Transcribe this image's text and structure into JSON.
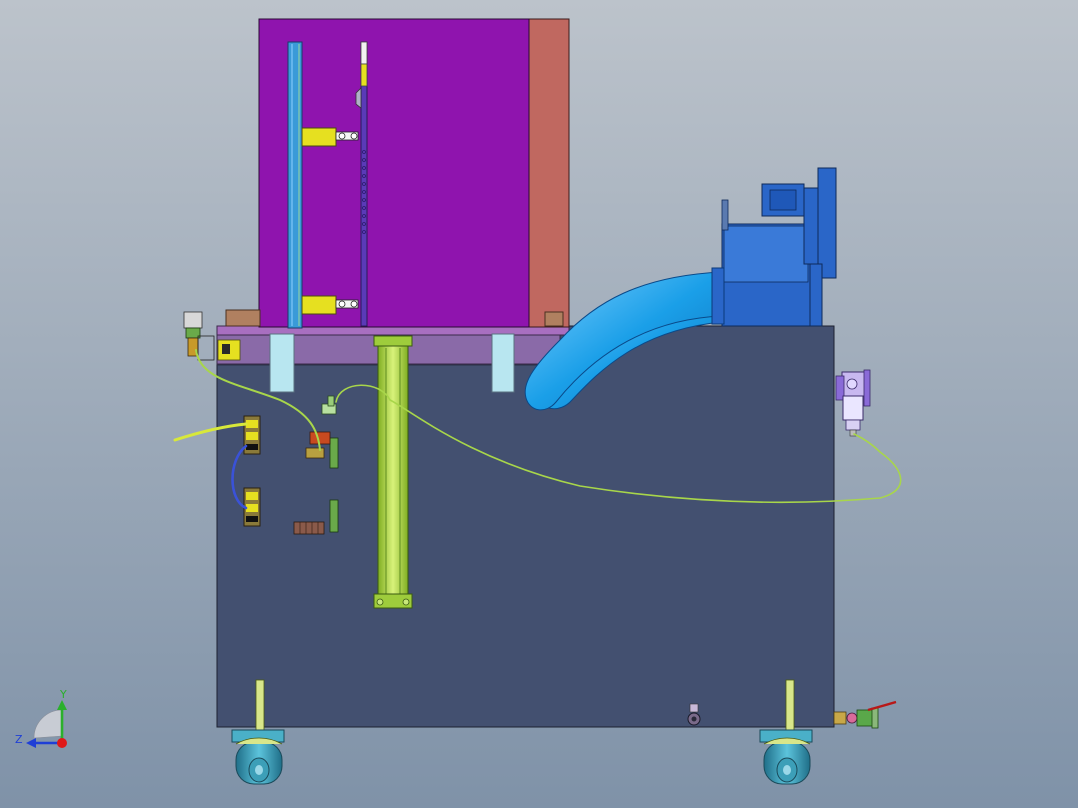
{
  "viewport": {
    "background_top": "#bcc3cb",
    "background_bottom": "#7f92a8"
  },
  "triad": {
    "y_label": "Y",
    "z_label": "Z",
    "y_color": "#2bb02b",
    "z_color": "#1f3fd6",
    "x_color": "#e01818"
  },
  "colors": {
    "cabinet_body": "#435070",
    "upper_enclosure": "#8f14ae",
    "enclosure_side": "#c06860",
    "top_plate": "#a86fc0",
    "cylinder": "#b4e04a",
    "blower": "#2a66c8",
    "duct": "#1a9fe8",
    "leg_post": "#d8e68a",
    "caster_wheel": "#3c9fb8",
    "air_hose": "#a8d64a",
    "bracket_yellow": "#e6e020",
    "spacer_post": "#b8e6f0",
    "pad": "#b08060"
  }
}
